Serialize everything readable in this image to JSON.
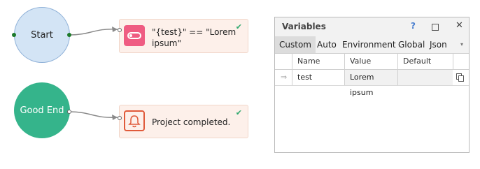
{
  "flow": {
    "start_label": "Start",
    "goodend_label": "Good End",
    "condition_text": "\"{test}\" == \"Lorem ipsum\"",
    "notification_text": "Project completed.",
    "check_mark": "✔"
  },
  "variables_panel": {
    "title": "Variables",
    "help": "?",
    "close": "✕",
    "tabs": [
      "Custom",
      "Auto",
      "Environment",
      "Global",
      "Json"
    ],
    "tab_dropdown": "▾",
    "columns": [
      "Name",
      "Value",
      "Default value"
    ],
    "rows": [
      {
        "name": "test",
        "value": "Lorem ipsum",
        "default": ""
      }
    ],
    "row_marker": "⇒"
  }
}
